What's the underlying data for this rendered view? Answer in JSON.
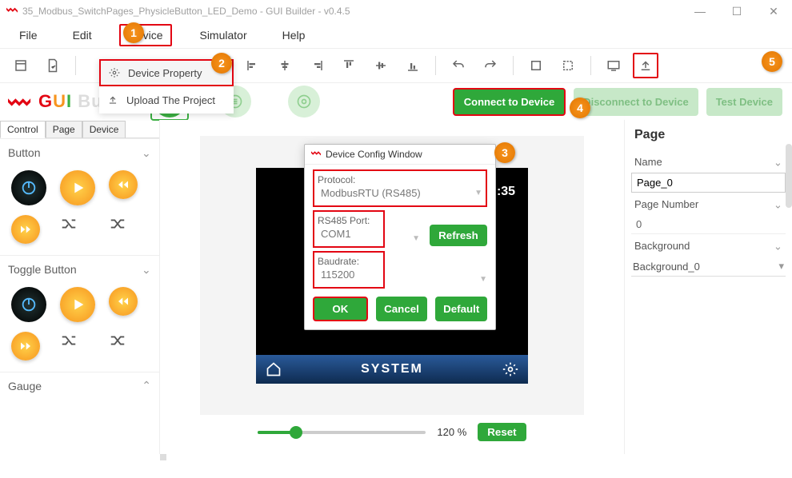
{
  "window": {
    "title": "35_Modbus_SwitchPages_PhysicleButton_LED_Demo - GUI Builder - v0.4.5",
    "minimize": "—",
    "maximize": "☐",
    "close": "✕"
  },
  "menubar": {
    "file": "File",
    "edit": "Edit",
    "device": "Device",
    "simulator": "Simulator",
    "help": "Help"
  },
  "device_menu": {
    "prop": "Device Property",
    "upload": "Upload The Project"
  },
  "markers": {
    "m1": "1",
    "m2": "2",
    "m3": "3",
    "m4": "4",
    "m5": "5"
  },
  "brand": {
    "g": "G",
    "u": "U",
    "i": "I",
    "rest": " Builder"
  },
  "conn": {
    "connect": "Connect to Device",
    "disconnect": "Disconnect to Device",
    "test": "Test Device"
  },
  "left": {
    "tabs": {
      "control": "Control",
      "page": "Page",
      "device": "Device"
    },
    "section_button": "Button",
    "section_toggle": "Toggle Button",
    "section_gauge": "Gauge"
  },
  "canvas": {
    "time_fragment": ":35",
    "footer_label": "SYSTEM"
  },
  "zoom": {
    "pct": "120 %",
    "reset": "Reset"
  },
  "right": {
    "title": "Page",
    "name_label": "Name",
    "name_value": "Page_0",
    "num_label": "Page Number",
    "num_value": "0",
    "bg_label": "Background",
    "bg_value": "Background_0"
  },
  "dialog": {
    "title": "Device Config Window",
    "protocol_label": "Protocol:",
    "protocol_value": "ModbusRTU (RS485)",
    "port_label": "RS485 Port:",
    "port_value": "COM1",
    "baud_label": "Baudrate:",
    "baud_value": "115200",
    "refresh": "Refresh",
    "ok": "OK",
    "cancel": "Cancel",
    "default": "Default"
  }
}
